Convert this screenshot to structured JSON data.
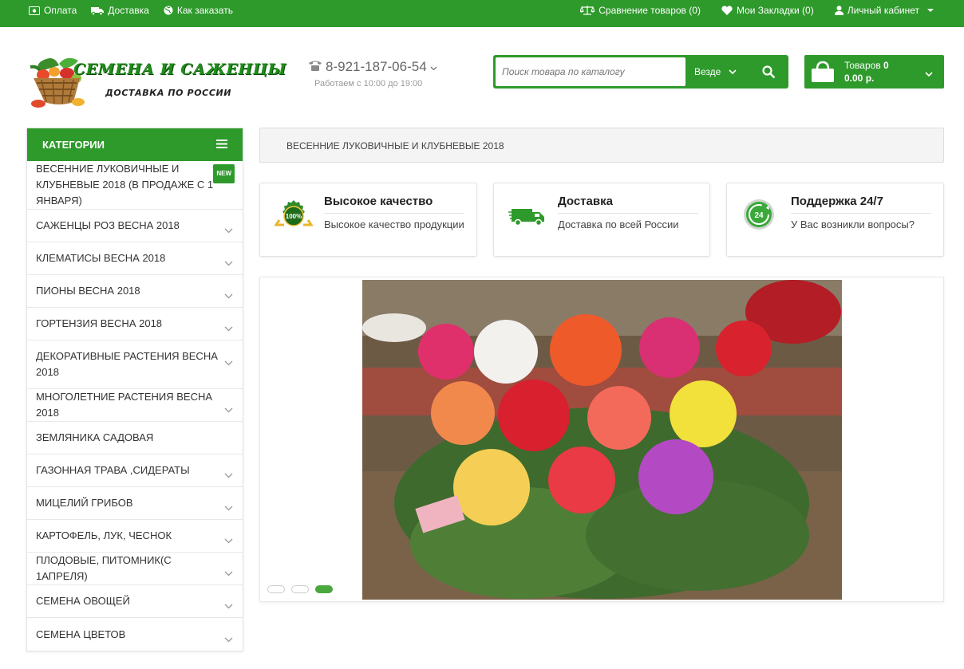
{
  "topbar": {
    "payment": "Оплата",
    "delivery": "Доставка",
    "how_to_order": "Как заказать",
    "compare": "Сравнение товаров (0)",
    "bookmarks": "Мои Закладки (0)",
    "account": "Личный кабинет"
  },
  "logo": {
    "line1": "СЕМЕНА И САЖЕНЦЫ",
    "line2": "ДОСТАВКА ПО РОССИИ"
  },
  "phone": {
    "number": "8-921-187-06-54",
    "hours": "Работаем с 10:00 до 19:00"
  },
  "search": {
    "placeholder": "Поиск товара по каталогу",
    "scope": "Везде"
  },
  "cart": {
    "label": "Товаров",
    "count": "0",
    "total": "0.00 р."
  },
  "sidebar": {
    "title": "КАТЕГОРИИ",
    "new_badge": "NEW",
    "items": [
      {
        "label": "ВЕСЕННИЕ ЛУКОВИЧНЫЕ И КЛУБНЕВЫЕ 2018 (В ПРОДАЖЕ С 1 ЯНВАРЯ)"
      },
      {
        "label": "САЖЕНЦЫ РОЗ ВЕСНА 2018"
      },
      {
        "label": "КЛЕМАТИСЫ ВЕСНА 2018"
      },
      {
        "label": "ПИОНЫ ВЕСНА 2018"
      },
      {
        "label": "ГОРТЕНЗИЯ ВЕСНА 2018"
      },
      {
        "label": "ДЕКОРАТИВНЫЕ РАСТЕНИЯ ВЕСНА 2018"
      },
      {
        "label": "МНОГОЛЕТНИЕ РАСТЕНИЯ ВЕСНА 2018"
      },
      {
        "label": "ЗЕМЛЯНИКА САДОВАЯ"
      },
      {
        "label": "ГАЗОННАЯ ТРАВА ,СИДЕРАТЫ"
      },
      {
        "label": "МИЦЕЛИЙ ГРИБОВ"
      },
      {
        "label": "КАРТОФЕЛЬ, ЛУК, ЧЕСНОК"
      },
      {
        "label": "ПЛОДОВЫЕ, ПИТОМНИК(С 1АПРЕЛЯ)"
      },
      {
        "label": "СЕМЕНА ОВОЩЕЙ"
      },
      {
        "label": "СЕМЕНА ЦВЕТОВ"
      }
    ]
  },
  "breadcrumb": {
    "current": "ВЕСЕННИЕ ЛУКОВИЧНЫЕ И КЛУБНЕВЫЕ 2018"
  },
  "features": [
    {
      "title": "Высокое качество",
      "text": "Высокое качество продукции",
      "icon": "quality-seal-icon",
      "seal": "100%"
    },
    {
      "title": "Доставка",
      "text": "Доставка по всей России",
      "icon": "delivery-truck-icon"
    },
    {
      "title": "Поддержка 24/7",
      "text": "У Вас возникли вопросы?",
      "icon": "support-24-icon",
      "seal": "24"
    }
  ],
  "slider": {
    "slide_count": 3,
    "active_slide": 3
  },
  "colors": {
    "brand_green": "#2e9a2b"
  }
}
